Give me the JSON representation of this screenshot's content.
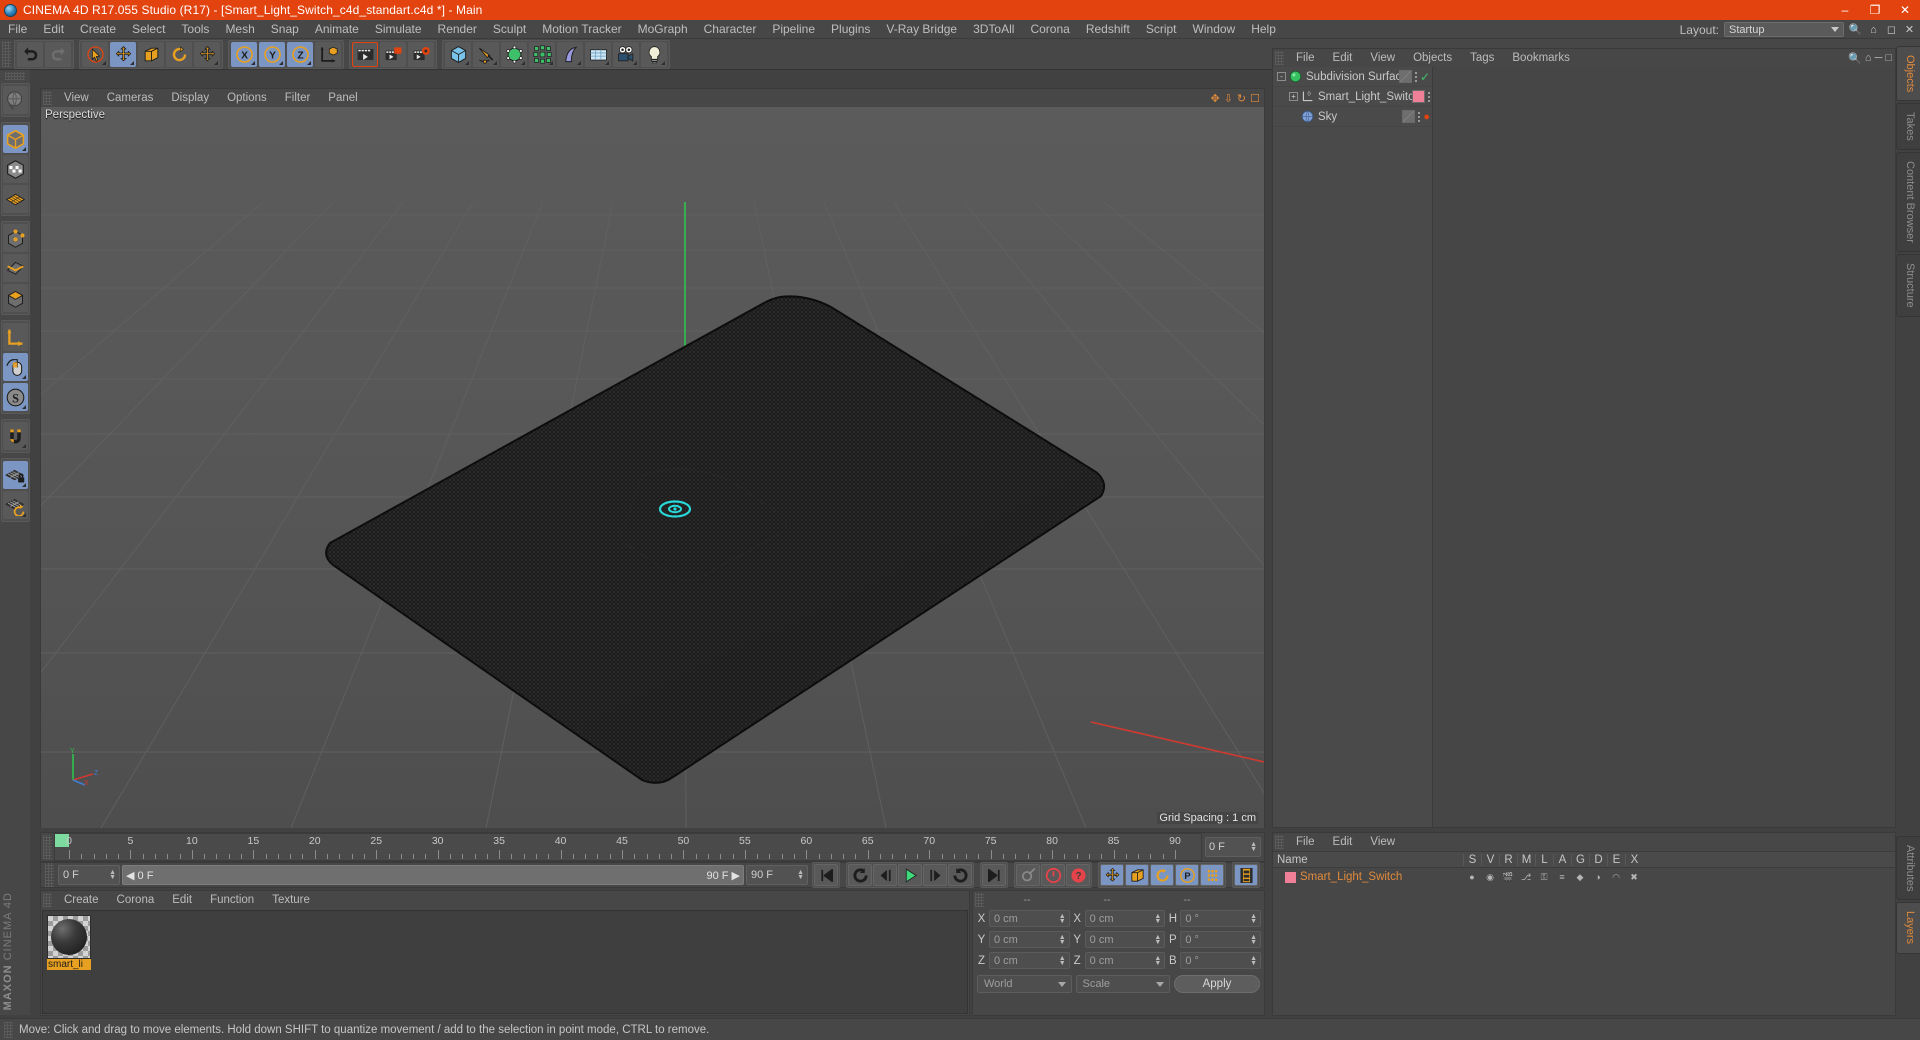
{
  "window": {
    "title": "CINEMA 4D R17.055 Studio (R17) - [Smart_Light_Switch_c4d_standart.c4d *] - Main",
    "minimize": "–",
    "maximize": "❐",
    "close": "✕"
  },
  "menubar": {
    "items": [
      "File",
      "Edit",
      "Create",
      "Select",
      "Tools",
      "Mesh",
      "Snap",
      "Animate",
      "Simulate",
      "Render",
      "Sculpt",
      "Motion Tracker",
      "MoGraph",
      "Character",
      "Pipeline",
      "Plugins",
      "V-Ray Bridge",
      "3DToAll",
      "Corona",
      "Redshift",
      "Script",
      "Window",
      "Help"
    ],
    "layout_label": "Layout:",
    "layout_value": "Startup"
  },
  "toolbar": {
    "groups": [
      {
        "name": "history",
        "buttons": [
          {
            "name": "undo-button",
            "icon": "undo-icon",
            "state": "normal"
          },
          {
            "name": "redo-button",
            "icon": "redo-icon",
            "state": "disabled"
          }
        ]
      },
      {
        "name": "transform",
        "buttons": [
          {
            "name": "live-selection-button",
            "icon": "live-selection-icon",
            "state": "dropdown"
          },
          {
            "name": "move-button",
            "icon": "move-icon",
            "state": "active"
          },
          {
            "name": "scale-button",
            "icon": "scale-icon",
            "state": "normal"
          },
          {
            "name": "rotate-button",
            "icon": "rotate-icon",
            "state": "normal"
          },
          {
            "name": "move-duplicate-button",
            "icon": "move-alt-icon",
            "state": "dropdown"
          }
        ]
      },
      {
        "name": "axis-locks",
        "buttons": [
          {
            "name": "lock-x-button",
            "icon": "axis-x-icon",
            "state": "active"
          },
          {
            "name": "lock-y-button",
            "icon": "axis-y-icon",
            "state": "active"
          },
          {
            "name": "lock-z-button",
            "icon": "axis-z-icon",
            "state": "active"
          },
          {
            "name": "world-object-coords-button",
            "icon": "world-axis-icon",
            "state": "normal"
          }
        ]
      },
      {
        "name": "render",
        "buttons": [
          {
            "name": "render-view-button",
            "icon": "render-view-icon",
            "state": "selected"
          },
          {
            "name": "render-region-button",
            "icon": "render-region-icon",
            "state": "normal"
          },
          {
            "name": "render-settings-button",
            "icon": "render-settings-icon",
            "state": "normal"
          }
        ]
      },
      {
        "name": "create",
        "buttons": [
          {
            "name": "cube-primitive-button",
            "icon": "cube-icon",
            "state": "dropdown"
          },
          {
            "name": "pen-spline-button",
            "icon": "pen-icon",
            "state": "dropdown"
          },
          {
            "name": "subdivision-surface-button",
            "icon": "generator-icon",
            "state": "dropdown"
          },
          {
            "name": "mograph-cloner-button",
            "icon": "cloner-icon",
            "state": "dropdown"
          },
          {
            "name": "bend-deformer-button",
            "icon": "deformer-icon",
            "state": "dropdown"
          },
          {
            "name": "floor-environment-button",
            "icon": "floor-icon",
            "state": "dropdown"
          },
          {
            "name": "camera-button",
            "icon": "camera-icon",
            "state": "dropdown"
          },
          {
            "name": "light-button",
            "icon": "light-icon",
            "state": "dropdown"
          }
        ]
      }
    ]
  },
  "lefttoolbar": {
    "groups": [
      {
        "name": "mode-global",
        "buttons": [
          {
            "name": "make-editable-button",
            "icon": "globe-icon",
            "state": "normal"
          }
        ]
      },
      {
        "name": "component-modes",
        "buttons": [
          {
            "name": "model-mode-button",
            "icon": "model-mode-icon",
            "state": "active"
          },
          {
            "name": "texture-mode-button",
            "icon": "texture-mode-icon",
            "state": "normal"
          },
          {
            "name": "uv-polygon-mode-button",
            "icon": "uv-mesh-icon",
            "state": "normal"
          }
        ]
      },
      {
        "name": "element-modes",
        "buttons": [
          {
            "name": "point-mode-button",
            "icon": "point-mode-icon",
            "state": "normal"
          },
          {
            "name": "edge-mode-button",
            "icon": "edge-mode-icon",
            "state": "normal"
          },
          {
            "name": "polygon-mode-button",
            "icon": "polygon-mode-icon",
            "state": "normal"
          }
        ]
      },
      {
        "name": "axis-tools",
        "buttons": [
          {
            "name": "enable-axis-button",
            "icon": "axis-l-icon",
            "state": "normal"
          },
          {
            "name": "viewport-solo-button",
            "icon": "mouse-icon",
            "state": "active"
          },
          {
            "name": "snap-settings-button",
            "icon": "snap-s-icon",
            "state": "active"
          }
        ]
      },
      {
        "name": "magnet",
        "buttons": [
          {
            "name": "magnet-tool-button",
            "icon": "magnet-icon",
            "state": "normal"
          }
        ]
      },
      {
        "name": "workplane",
        "buttons": [
          {
            "name": "lock-workplane-button",
            "icon": "workplane-lock-icon",
            "state": "active"
          },
          {
            "name": "align-workplane-button",
            "icon": "workplane-align-icon",
            "state": "normal"
          }
        ]
      }
    ],
    "brand_line1": "MAXON",
    "brand_line2": "CINEMA 4D"
  },
  "viewport": {
    "menu": [
      "View",
      "Cameras",
      "Display",
      "Options",
      "Filter",
      "Panel"
    ],
    "label": "Perspective",
    "grid_spacing": "Grid Spacing : 1 cm",
    "axis_labels": {
      "y": "Y",
      "x": "X",
      "z": "Z"
    }
  },
  "object_manager": {
    "menu": [
      "File",
      "Edit",
      "View",
      "Objects",
      "Tags",
      "Bookmarks"
    ],
    "rows": [
      {
        "name": "Subdivision Surface",
        "icon": "subdivision-surface-icon",
        "icon_color": "#35c15f",
        "indent": 0,
        "twirl": "-",
        "tag_color": "#6a6a6a",
        "check": true,
        "dot": null
      },
      {
        "name": "Smart_Light_Switch",
        "icon": "null-object-icon",
        "icon_color": "#c9c9c9",
        "indent": 1,
        "twirl": "+",
        "tag_color": "#f08098",
        "check": false,
        "dot": null
      },
      {
        "name": "Sky",
        "icon": "sky-object-icon",
        "icon_color": "#7f9fd6",
        "indent": 1,
        "twirl": "",
        "tag_color": "#6a6a6a",
        "check": false,
        "dot": "#e2430f"
      }
    ]
  },
  "side_tabs_top": [
    "Objects",
    "Takes",
    "Content Browser",
    "Structure"
  ],
  "side_tabs_top_active": "Objects",
  "side_tabs_bottom": [
    "Attributes",
    "Layers"
  ],
  "side_tabs_bottom_active": "Layers",
  "timeline": {
    "ticks": [
      0,
      5,
      10,
      15,
      20,
      25,
      30,
      35,
      40,
      45,
      50,
      55,
      60,
      65,
      70,
      75,
      80,
      85,
      90
    ],
    "min": 0,
    "max": 90,
    "current_frame_box": "0 F",
    "playhead_frame": 0
  },
  "playbar": {
    "current_frame": "0 F",
    "range_start": "0 F",
    "range_end": "90 F",
    "end_frame": "90 F",
    "buttons": [
      {
        "name": "go-to-start-button",
        "icon": "skip-start-icon",
        "state": "normal"
      },
      {
        "name": "play-backwards-button",
        "icon": "rewind-loop-icon",
        "state": "normal"
      },
      {
        "name": "previous-frame-button",
        "icon": "step-back-icon",
        "state": "normal"
      },
      {
        "name": "play-button",
        "icon": "play-icon",
        "state": "normal"
      },
      {
        "name": "next-frame-button",
        "icon": "step-forward-icon",
        "state": "normal"
      },
      {
        "name": "play-forwards-button",
        "icon": "forward-loop-icon",
        "state": "normal"
      },
      {
        "name": "go-to-end-button",
        "icon": "skip-end-icon",
        "state": "normal"
      },
      {
        "name": "autokeying-button",
        "icon": "key-icon",
        "state": "disabled"
      },
      {
        "name": "record-active-objects-button",
        "icon": "record-icon",
        "state": "normal"
      },
      {
        "name": "keyframe-selection-button",
        "icon": "question-record-icon",
        "state": "normal"
      },
      {
        "name": "key-position-button",
        "icon": "key-position-icon",
        "state": "active"
      },
      {
        "name": "key-scale-button",
        "icon": "key-scale-icon",
        "state": "active"
      },
      {
        "name": "key-rotation-button",
        "icon": "key-rotation-icon",
        "state": "active"
      },
      {
        "name": "key-parameter-button",
        "icon": "key-param-icon",
        "state": "active"
      },
      {
        "name": "key-pla-button",
        "icon": "key-pla-icon",
        "state": "active"
      },
      {
        "name": "timeline-toggle-button",
        "icon": "filmstrip-icon",
        "state": "active"
      }
    ]
  },
  "material_manager": {
    "menu": [
      "Create",
      "Corona",
      "Edit",
      "Function",
      "Texture"
    ],
    "materials": [
      {
        "name": "smart_li",
        "full_name": "smart_light_switch"
      }
    ]
  },
  "coordinates": {
    "headers": [
      "--",
      "--",
      "--"
    ],
    "rows": [
      {
        "label_pos": "X",
        "value_pos": "0 cm",
        "label_size": "X",
        "value_size": "0 cm",
        "label_rot": "H",
        "value_rot": "0 °"
      },
      {
        "label_pos": "Y",
        "value_pos": "0 cm",
        "label_size": "Y",
        "value_size": "0 cm",
        "label_rot": "P",
        "value_rot": "0 °"
      },
      {
        "label_pos": "Z",
        "value_pos": "0 cm",
        "label_size": "Z",
        "value_size": "0 cm",
        "label_rot": "B",
        "value_rot": "0 °"
      }
    ],
    "system": "World",
    "mode": "Scale",
    "apply": "Apply"
  },
  "layers_panel": {
    "menu": [
      "File",
      "Edit",
      "View"
    ],
    "name_header": "Name",
    "columns": [
      "S",
      "V",
      "R",
      "M",
      "L",
      "A",
      "G",
      "D",
      "E",
      "X"
    ],
    "rows": [
      {
        "name": "Smart_Light_Switch",
        "color": "#f08098"
      }
    ]
  },
  "statusbar": {
    "text": "Move: Click and drag to move elements. Hold down SHIFT to quantize movement / add to the selection in point mode, CTRL to remove."
  },
  "colors": {
    "accent_orange": "#e2430f",
    "panel_bg": "#474747",
    "active_blue": "#7b96c2",
    "viewport_bg": "#555555",
    "label_orange": "#e08a3c"
  }
}
